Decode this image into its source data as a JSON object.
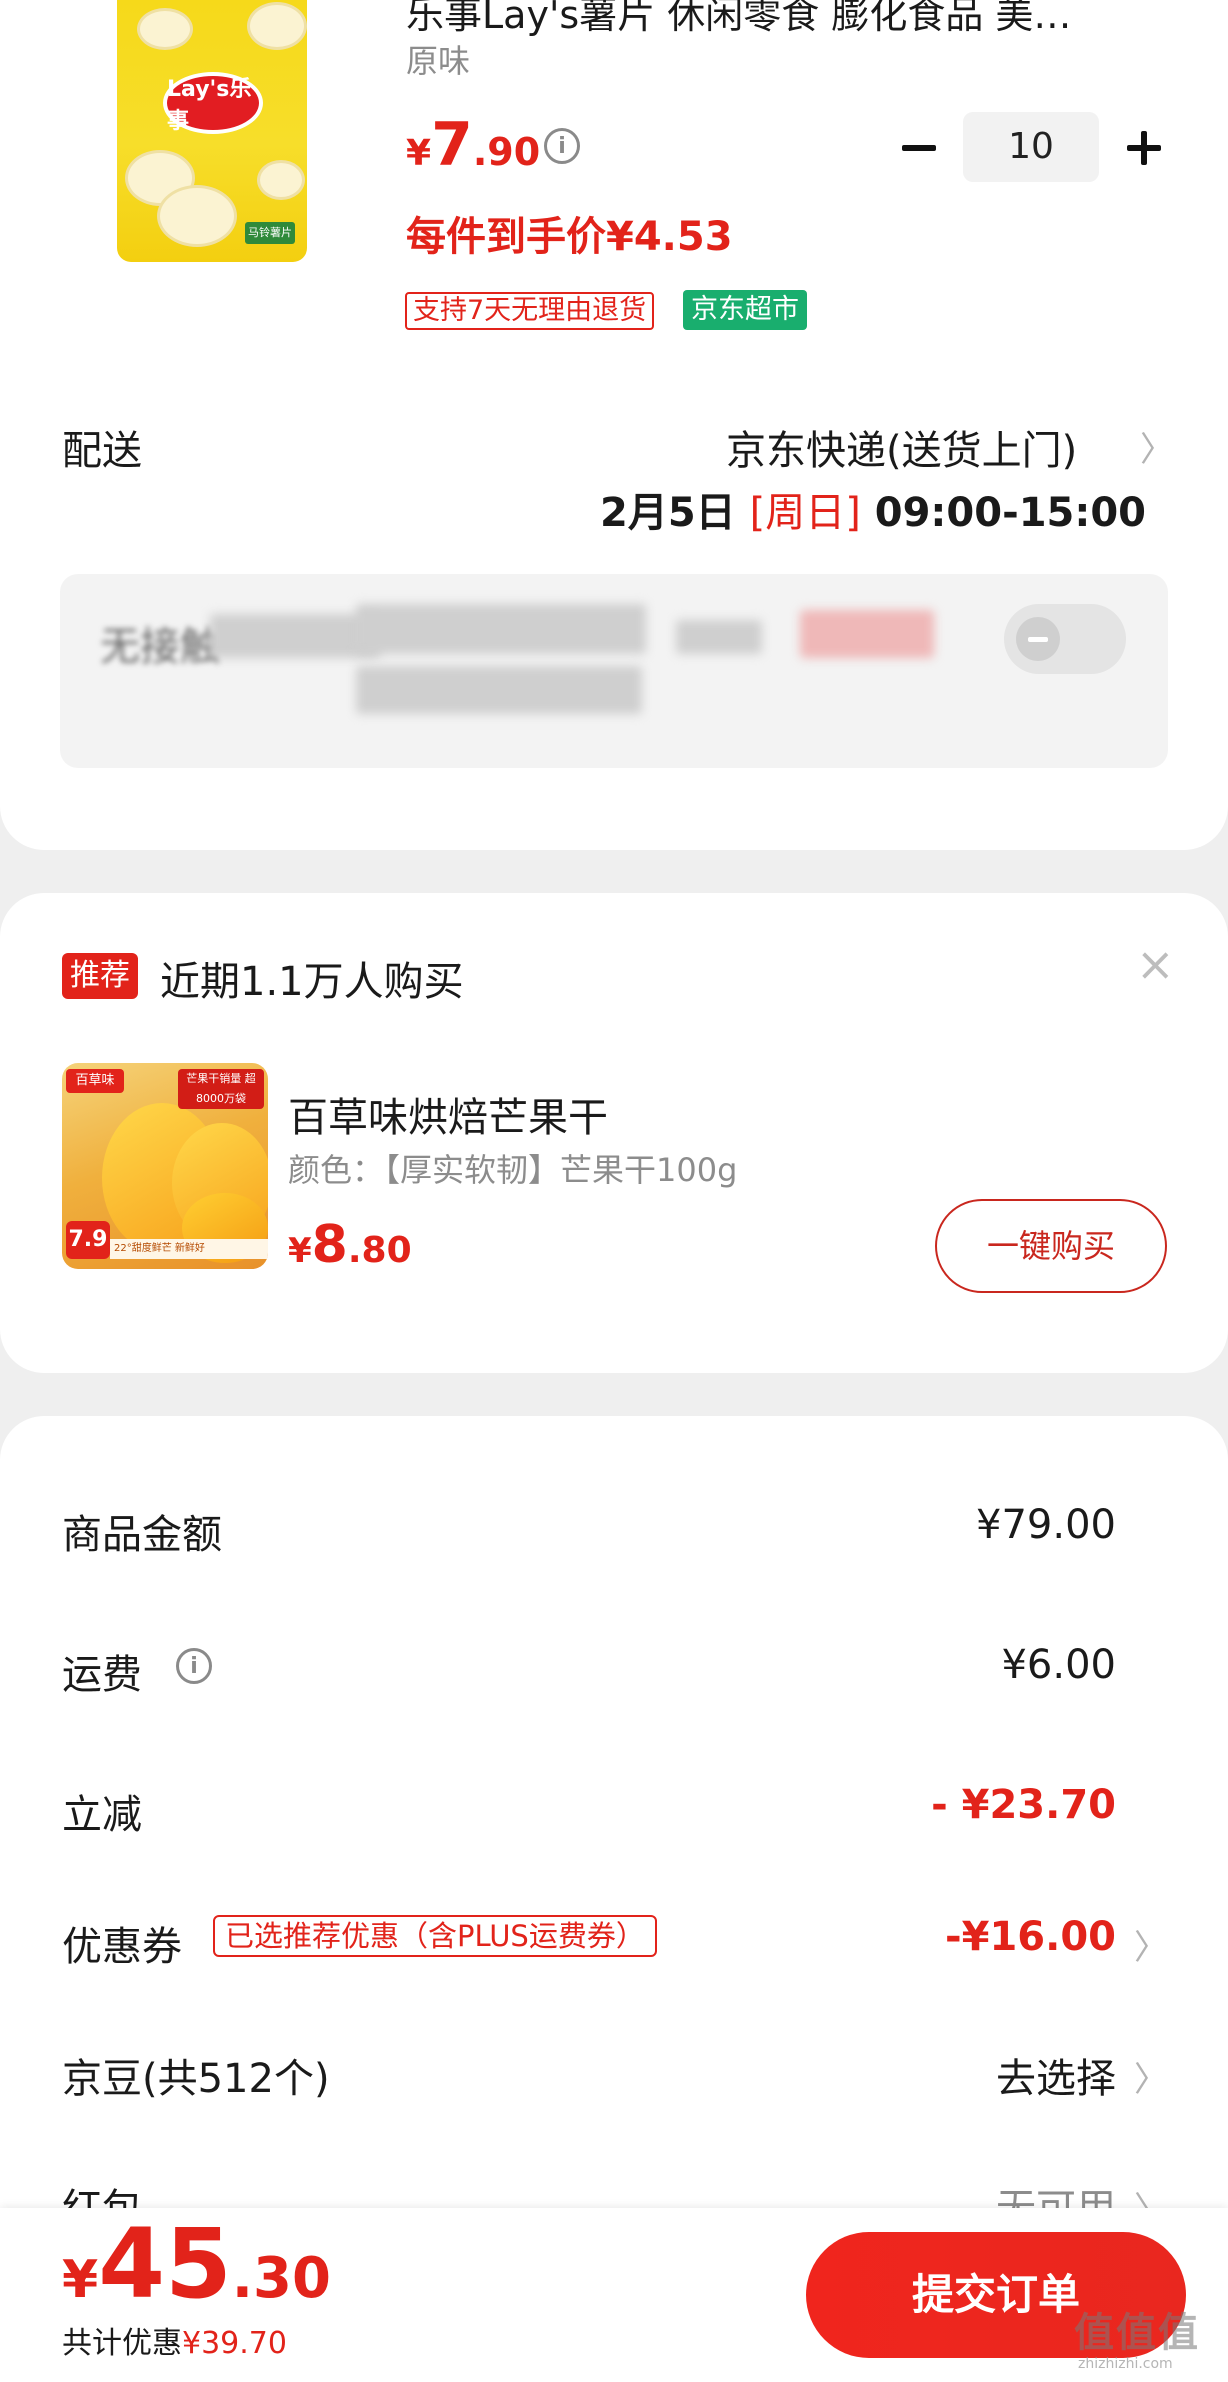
{
  "product": {
    "title": "乐事Lay's薯片 休闲零食 膨化食品 美…",
    "flavor": "原味",
    "price_symbol": "¥",
    "price_int": "7",
    "price_dec": ".90",
    "unit_price": "每件到手价¥4.53",
    "tag_return": "支持7天无理由退货",
    "tag_market": "京东超市",
    "quantity": "10",
    "bag_logo": "Lay's乐事",
    "bag_tag": "马铃薯片"
  },
  "delivery": {
    "label": "配送",
    "method": "京东快递(送货上门)",
    "date": "2月5日",
    "weekday": "[周日]",
    "time": "09:00-15:00",
    "contactless_text": "无接触"
  },
  "recommend": {
    "badge": "推荐",
    "title": "近期1.1万人购买",
    "name": "百草味烘焙芒果干",
    "spec": "颜色：【厚实软韧】芒果干100g",
    "price_symbol": "¥",
    "price_int": "8",
    "price_dec": ".80",
    "buy_label": "一键购买",
    "image_brand": "百草味",
    "image_flag": "芒果干销量 超8000万袋",
    "image_price": "7.9",
    "image_strip": "22°甜度鲜芒 新鲜好"
  },
  "summary": {
    "rows": [
      {
        "label": "商品金额",
        "value": "¥79.00"
      },
      {
        "label": "运费",
        "value": "¥6.00"
      },
      {
        "label": "立减",
        "value": "- ¥23.70"
      },
      {
        "label": "优惠券",
        "value": "-¥16.00",
        "tag": "已选推荐优惠（含PLUS运费券）"
      },
      {
        "label": "京豆(共512个)",
        "value": "去选择"
      },
      {
        "label": "红包",
        "value": "无可用"
      }
    ]
  },
  "footer": {
    "price_symbol": "¥",
    "price_int": "45",
    "price_dec": ".30",
    "saving_label": "共计优惠",
    "saving_amount": "¥39.70",
    "submit_label": "提交订单",
    "watermark": "值值值",
    "watermark_sub": "zhizhizhi.com"
  },
  "icons": {
    "info": "info-icon",
    "chevron": "chevron-right-icon",
    "close": "close-icon",
    "minus": "minus-icon",
    "plus": "plus-icon"
  },
  "colors": {
    "accent": "#e2231a",
    "market_green": "#19ae6e",
    "background": "#efefef"
  }
}
